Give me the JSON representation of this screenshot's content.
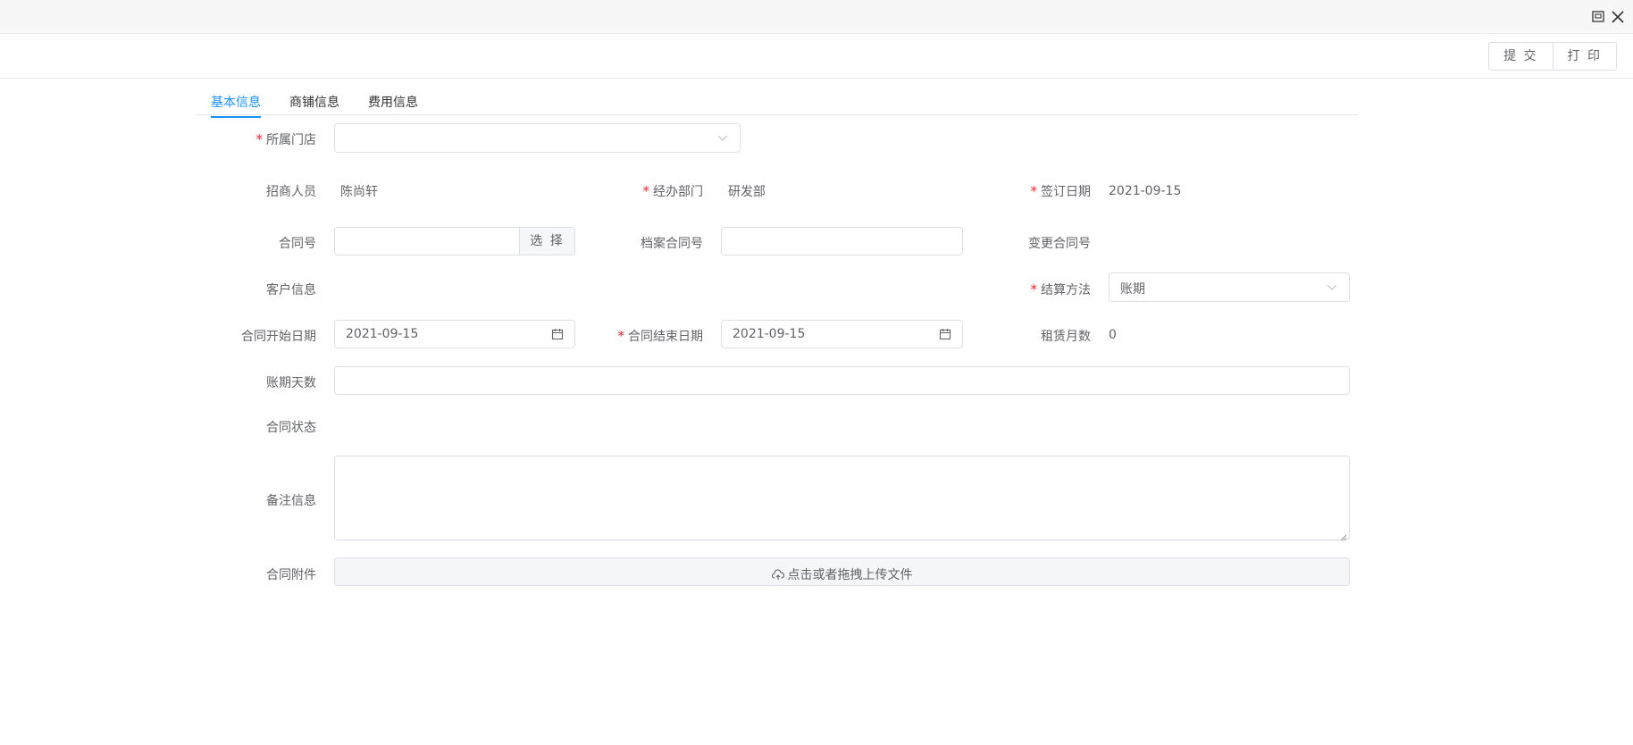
{
  "toolbar": {
    "submit_label": "提 交",
    "print_label": "打 印"
  },
  "tabs": [
    {
      "label": "基本信息",
      "active": true
    },
    {
      "label": "商铺信息",
      "active": false
    },
    {
      "label": "费用信息",
      "active": false
    }
  ],
  "form": {
    "store": {
      "label": "所属门店",
      "value": ""
    },
    "recruiter": {
      "label": "招商人员",
      "value": "陈尚轩"
    },
    "department": {
      "label": "经办部门",
      "value": "研发部"
    },
    "sign_date": {
      "label": "签订日期",
      "value": "2021-09-15"
    },
    "contract_no": {
      "label": "合同号",
      "value": "",
      "select_label": "选 择"
    },
    "archive_no": {
      "label": "档案合同号",
      "value": ""
    },
    "change_no": {
      "label": "变更合同号",
      "value": ""
    },
    "customer": {
      "label": "客户信息",
      "value": ""
    },
    "settlement": {
      "label": "结算方法",
      "value": "账期"
    },
    "start_date": {
      "label": "合同开始日期",
      "value": "2021-09-15"
    },
    "end_date": {
      "label": "合同结束日期",
      "value": "2021-09-15"
    },
    "lease_months": {
      "label": "租赁月数",
      "value": "0"
    },
    "credit_days": {
      "label": "账期天数",
      "value": ""
    },
    "status": {
      "label": "合同状态",
      "value": ""
    },
    "remarks": {
      "label": "备注信息",
      "value": ""
    },
    "attachment": {
      "label": "合同附件",
      "upload_label": "点击或者拖拽上传文件"
    }
  },
  "colors": {
    "accent": "#1890ff",
    "required": "#f5222d",
    "border": "#dcdfe6"
  }
}
